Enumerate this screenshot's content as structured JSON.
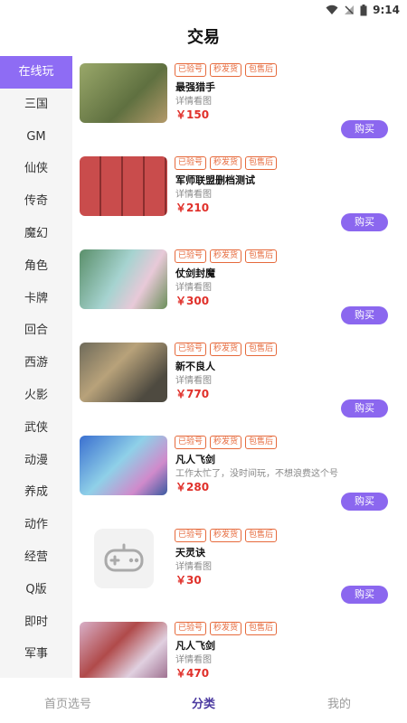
{
  "status": {
    "time": "9:14"
  },
  "header": {
    "title": "交易"
  },
  "sidebar": {
    "items": [
      "在线玩",
      "三国",
      "GM",
      "仙侠",
      "传奇",
      "魔幻",
      "角色",
      "卡牌",
      "回合",
      "西游",
      "火影",
      "武侠",
      "动漫",
      "养成",
      "动作",
      "经营",
      "Q版",
      "即时",
      "军事"
    ]
  },
  "tags": [
    "已验号",
    "秒发货",
    "包售后"
  ],
  "buy_label": "购买",
  "listings": [
    {
      "name": "最强猎手",
      "desc": "详情看图",
      "price": "￥150",
      "thumb_color": "#7a8b5a"
    },
    {
      "name": "军师联盟删档测试",
      "desc": "详情看图",
      "price": "￥210",
      "thumb_color": "#c24a4a"
    },
    {
      "name": "仗剑封魔",
      "desc": "详情看图",
      "price": "￥300",
      "thumb_color": "#7fb3b0"
    },
    {
      "name": "新不良人",
      "desc": "详情看图",
      "price": "￥770",
      "thumb_color": "#8a7a5e"
    },
    {
      "name": "凡人飞剑",
      "desc": "工作太忙了，没时间玩，不想浪费这个号",
      "price": "￥280",
      "thumb_color": "#5a86c8"
    },
    {
      "name": "天灵诀",
      "desc": "详情看图",
      "price": "￥30",
      "thumb_color": "#f0f0f0"
    },
    {
      "name": "凡人飞剑",
      "desc": "详情看图",
      "price": "￥470",
      "thumb_color": "#c8a4b8"
    }
  ],
  "tabbar": {
    "home": "首页选号",
    "category": "分类",
    "mine": "我的"
  }
}
